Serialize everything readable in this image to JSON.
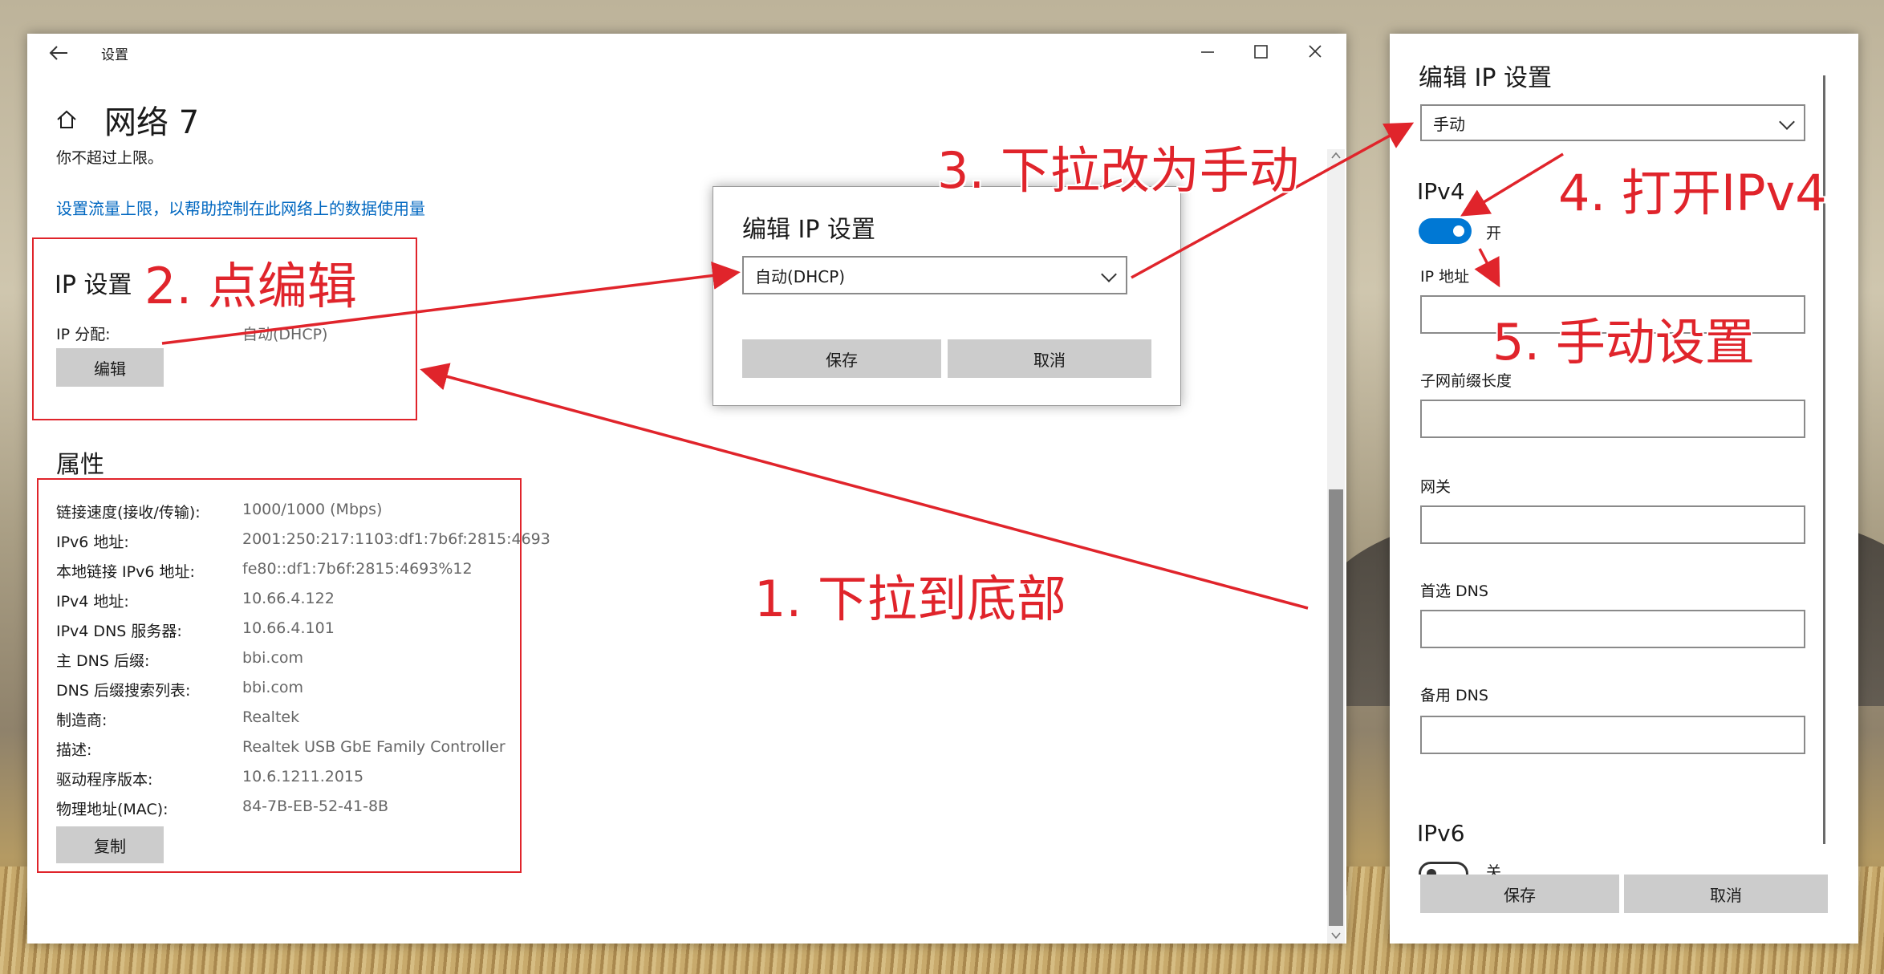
{
  "settings_window": {
    "title": "设置",
    "page_title": "网络 7",
    "subtitle": "你不超过上限。",
    "data_limit_link": "设置流量上限，以帮助控制在此网络上的数据使用量",
    "ip_section": {
      "heading": "IP 设置",
      "assignment_label": "IP 分配:",
      "assignment_value": "自动(DHCP)",
      "edit_button": "编辑"
    },
    "properties": {
      "heading": "属性",
      "rows": [
        {
          "label": "链接速度(接收/传输):",
          "value": "1000/1000 (Mbps)"
        },
        {
          "label": "IPv6 地址:",
          "value": "2001:250:217:1103:df1:7b6f:2815:4693"
        },
        {
          "label": "本地链接 IPv6 地址:",
          "value": "fe80::df1:7b6f:2815:4693%12"
        },
        {
          "label": "IPv4 地址:",
          "value": "10.66.4.122"
        },
        {
          "label": "IPv4 DNS 服务器:",
          "value": "10.66.4.101"
        },
        {
          "label": "主 DNS 后缀:",
          "value": "bbi.com"
        },
        {
          "label": "DNS 后缀搜索列表:",
          "value": "bbi.com"
        },
        {
          "label": "制造商:",
          "value": "Realtek"
        },
        {
          "label": "描述:",
          "value": "Realtek USB GbE Family Controller"
        },
        {
          "label": "驱动程序版本:",
          "value": "10.6.1211.2015"
        },
        {
          "label": "物理地址(MAC):",
          "value": "84-7B-EB-52-41-8B"
        }
      ],
      "copy_button": "复制"
    }
  },
  "edit_dialog_small": {
    "title": "编辑 IP 设置",
    "select_value": "自动(DHCP)",
    "save_button": "保存",
    "cancel_button": "取消"
  },
  "edit_dialog_large": {
    "title": "编辑 IP 设置",
    "select_value": "手动",
    "ipv4_heading": "IPv4",
    "ipv4_toggle_label": "开",
    "ipv4_toggle_on": true,
    "fields": {
      "ip_address": "IP 地址",
      "subnet_prefix": "子网前缀长度",
      "gateway": "网关",
      "preferred_dns": "首选 DNS",
      "alternate_dns": "备用 DNS"
    },
    "ipv6_heading": "IPv6",
    "ipv6_toggle_label": "关",
    "save_button": "保存",
    "cancel_button": "取消"
  },
  "annotations": {
    "step1": "1. 下拉到底部",
    "step2": "2. 点编辑",
    "step3": "3. 下拉改为手动",
    "step4": "4. 打开IPv4",
    "step5": "5. 手动设置"
  },
  "colors": {
    "annotation_red": "#e0242b",
    "toggle_blue": "#0078d4",
    "link_blue": "#0067c0",
    "button_gray": "#cccccc"
  }
}
